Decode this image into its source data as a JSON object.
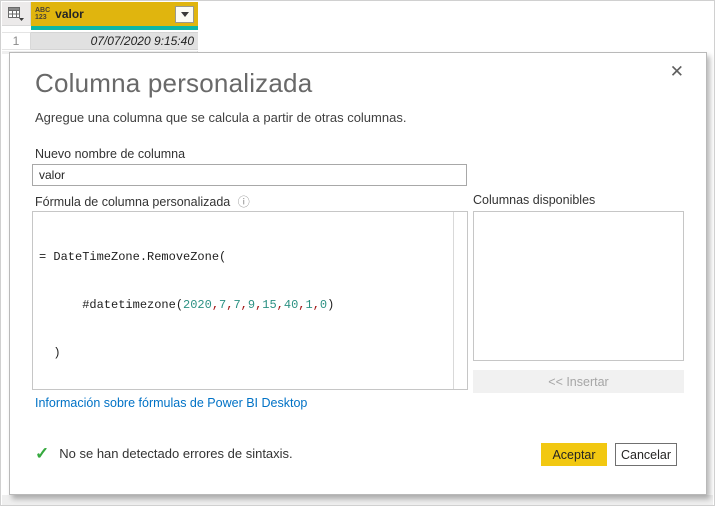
{
  "colors": {
    "header_yellow": "#e0b50e",
    "quality_bar_teal": "#0db7a4",
    "accept_yellow": "#f2c811",
    "link_blue": "#0072c6",
    "check_green": "#36a93f",
    "number_teal": "#2c9183"
  },
  "table_preview": {
    "column": {
      "type_line1": "ABC",
      "type_line2": "123",
      "name": "valor"
    },
    "rows": [
      {
        "index": "1",
        "value": "07/07/2020 9:15:40"
      }
    ]
  },
  "dialog": {
    "close_glyph": "✕",
    "title": "Columna personalizada",
    "subtitle": "Agregue una columna que se calcula a partir de otras columnas.",
    "name_label": "Nuevo nombre de columna",
    "name_value": "valor",
    "formula_label": "Fórmula de columna personalizada",
    "info_glyph": "ⓘ",
    "formula": {
      "line1": "= DateTimeZone.RemoveZone(",
      "line2_prefix": "      #datetimezone(",
      "args": [
        "2020",
        "7",
        "7",
        "9",
        "15",
        "40",
        "1",
        "0"
      ],
      "separator": ",",
      "line2_suffix": ")",
      "line3": "  )"
    },
    "available_columns_label": "Columnas disponibles",
    "insert_button": "<< Insertar",
    "link": "Información sobre fórmulas de Power BI Desktop",
    "check_glyph": "✓",
    "syntax_message": "No se han detectado errores de sintaxis.",
    "accept_button": "Aceptar",
    "cancel_button": "Cancelar"
  }
}
